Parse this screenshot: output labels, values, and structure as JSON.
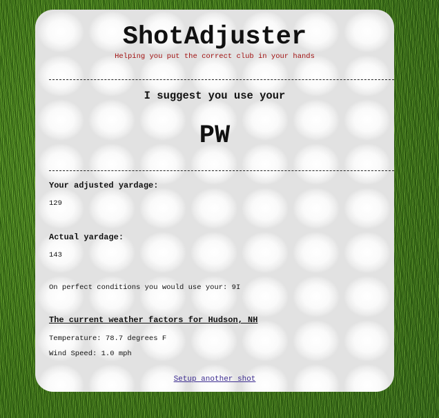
{
  "app": {
    "title": "ShotAdjuster",
    "tagline": "Helping you put the correct club in your hands"
  },
  "suggestion": {
    "intro": "I suggest you use your",
    "club": "PW"
  },
  "adjusted": {
    "label": "Your adjusted yardage:",
    "value": "129"
  },
  "actual": {
    "label": "Actual yardage:",
    "value": "143"
  },
  "perfect_conditions": {
    "text": "On perfect conditions you would use your: 9I"
  },
  "weather": {
    "title": "The current weather factors for Hudson, NH",
    "temperature": "Temperature: 78.7 degrees F",
    "wind_speed": "Wind Speed: 1.0 mph"
  },
  "footer": {
    "link_label": "Setup another shot"
  },
  "colors": {
    "tagline": "#a01010",
    "link": "#3b2b8f",
    "grass": "#4f8a22"
  }
}
